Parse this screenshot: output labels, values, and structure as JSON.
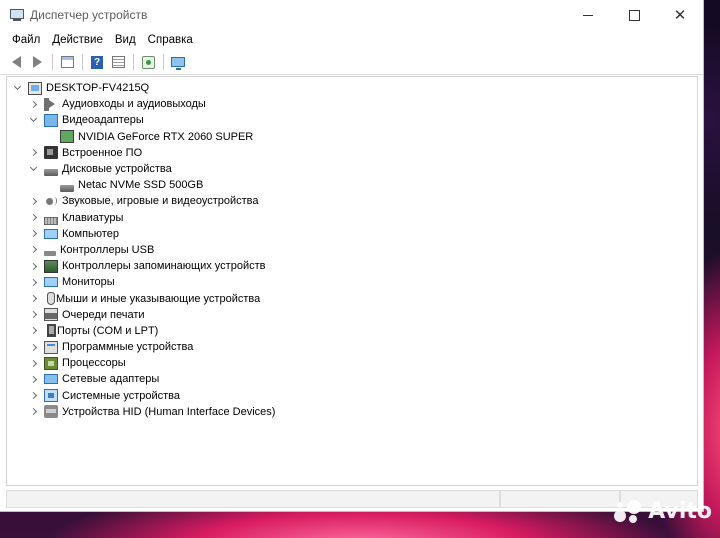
{
  "window": {
    "title": "Диспетчер устройств",
    "controls": {
      "minimize": "",
      "maximize": "",
      "close": "✕"
    }
  },
  "menu": [
    "Файл",
    "Действие",
    "Вид",
    "Справка"
  ],
  "toolbar": {
    "buttons": [
      "back-arrow-icon",
      "forward-arrow-icon",
      "properties-icon",
      "help-icon",
      "view-icon",
      "scan-hardware-icon",
      "monitor-icon"
    ]
  },
  "tree": {
    "root": "DESKTOP-FV4215Q",
    "items": [
      {
        "label": "Аудиовходы и аудиовыходы",
        "icon": "audio-io-icon",
        "expanded": false
      },
      {
        "label": "Видеоадаптеры",
        "icon": "display-adapter-icon",
        "expanded": true,
        "children": [
          {
            "label": "NVIDIA GeForce RTX 2060 SUPER",
            "icon": "gpu-icon"
          }
        ]
      },
      {
        "label": "Встроенное ПО",
        "icon": "firmware-icon",
        "expanded": false
      },
      {
        "label": "Дисковые устройства",
        "icon": "disk-drive-icon",
        "expanded": true,
        "children": [
          {
            "label": "Netac NVMe SSD 500GB",
            "icon": "ssd-icon"
          }
        ]
      },
      {
        "label": "Звуковые, игровые и видеоустройства",
        "icon": "sound-icon",
        "expanded": false
      },
      {
        "label": "Клавиатуры",
        "icon": "keyboard-icon",
        "expanded": false
      },
      {
        "label": "Компьютер",
        "icon": "computer-icon",
        "expanded": false
      },
      {
        "label": "Контроллеры USB",
        "icon": "usb-icon",
        "expanded": false
      },
      {
        "label": "Контроллеры запоминающих устройств",
        "icon": "storage-controller-icon",
        "expanded": false
      },
      {
        "label": "Мониторы",
        "icon": "monitor-icon",
        "expanded": false
      },
      {
        "label": "Мыши и иные указывающие устройства",
        "icon": "mouse-icon",
        "expanded": false
      },
      {
        "label": "Очереди печати",
        "icon": "printer-icon",
        "expanded": false
      },
      {
        "label": "Порты (COM и LPT)",
        "icon": "port-icon",
        "expanded": false
      },
      {
        "label": "Программные устройства",
        "icon": "software-device-icon",
        "expanded": false
      },
      {
        "label": "Процессоры",
        "icon": "cpu-icon",
        "expanded": false
      },
      {
        "label": "Сетевые адаптеры",
        "icon": "network-adapter-icon",
        "expanded": false
      },
      {
        "label": "Системные устройства",
        "icon": "system-device-icon",
        "expanded": false
      },
      {
        "label": "Устройства HID (Human Interface Devices)",
        "icon": "hid-icon",
        "expanded": false
      }
    ]
  },
  "watermark": {
    "text": "Avito"
  }
}
